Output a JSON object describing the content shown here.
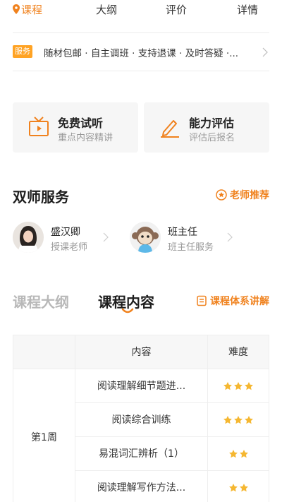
{
  "tabs": [
    {
      "label": "课程",
      "active": true
    },
    {
      "label": "大纲",
      "active": false
    },
    {
      "label": "评价",
      "active": false
    },
    {
      "label": "详情",
      "active": false
    }
  ],
  "service": {
    "badge": "服务",
    "text": "随材包邮 · 自主调班 · 支持退课 · 及时答疑 ·..."
  },
  "cards": [
    {
      "title": "免费试听",
      "subtitle": "重点内容精讲",
      "icon": "tv-icon"
    },
    {
      "title": "能力评估",
      "subtitle": "评估后报名",
      "icon": "pencil-icon"
    }
  ],
  "dual_teacher": {
    "title": "双师服务",
    "recommend": "老师推荐",
    "teachers": [
      {
        "name": "盛汉卿",
        "role": "授课老师"
      },
      {
        "name": "班主任",
        "role": "班主任服务"
      }
    ]
  },
  "syllabus": {
    "tab_outline": "课程大纲",
    "tab_content": "课程内容",
    "explain": "课程体系讲解"
  },
  "table": {
    "headers": [
      "",
      "内容",
      "难度"
    ],
    "week": "第1周",
    "rows": [
      {
        "content": "阅读理解细节题进...",
        "difficulty": 3
      },
      {
        "content": "阅读综合训练",
        "difficulty": 3
      },
      {
        "content": "易混词汇辨析（1）",
        "difficulty": 2
      },
      {
        "content": "阅读理解写作方法...",
        "difficulty": 2
      }
    ]
  },
  "colors": {
    "accent": "#f0821e",
    "badge": "#ffa324",
    "star": "#f5b731"
  }
}
